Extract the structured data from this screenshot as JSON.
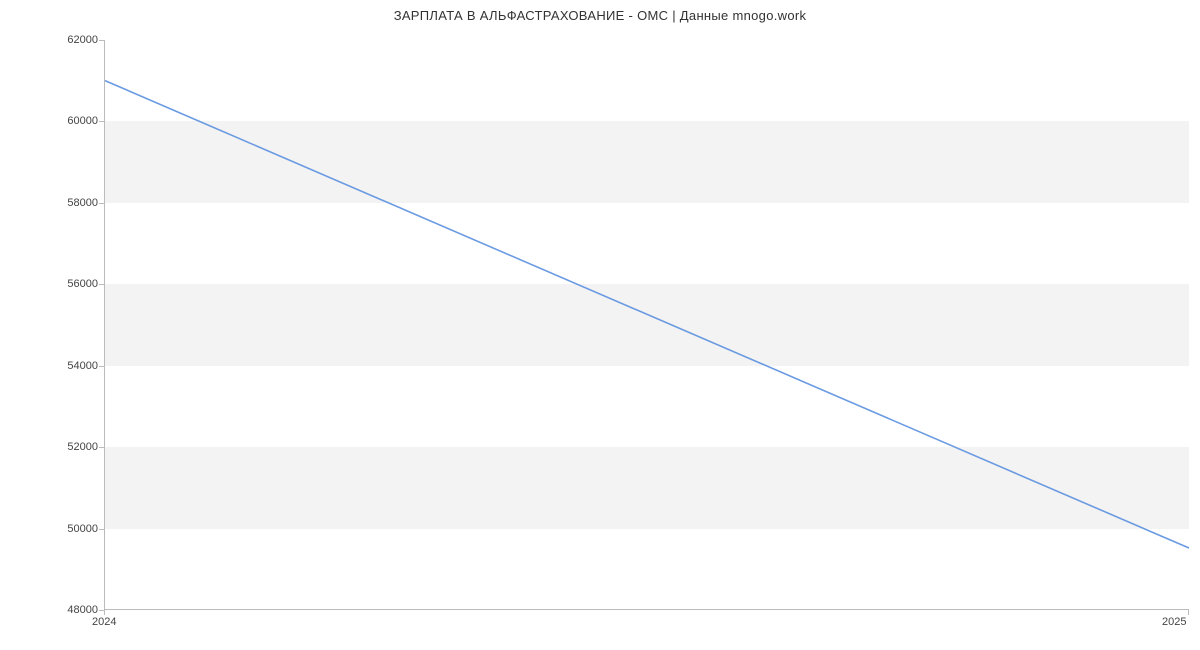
{
  "chart_data": {
    "type": "line",
    "title": "ЗАРПЛАТА В  АЛЬФАСТРАХОВАНИЕ - ОМС | Данные mnogo.work",
    "xlabel": "",
    "ylabel": "",
    "x_ticks": [
      "2024",
      "2025"
    ],
    "y_ticks": [
      48000,
      50000,
      52000,
      54000,
      56000,
      58000,
      60000,
      62000
    ],
    "ylim": [
      48000,
      62000
    ],
    "series": [
      {
        "name": "salary",
        "color": "#6a9ae2",
        "x": [
          "2024",
          "2025"
        ],
        "values": [
          61000,
          49500
        ]
      }
    ]
  }
}
